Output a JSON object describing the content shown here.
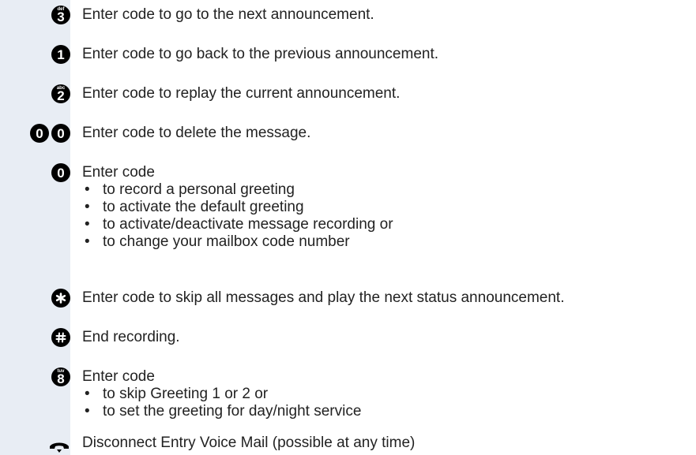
{
  "rows": [
    {
      "key": {
        "digit": "3",
        "letters": "def"
      },
      "text": "Enter code to go to the next announcement."
    },
    {
      "key": {
        "digit": "1",
        "letters": ""
      },
      "text": "Enter code to go back to the previous announcement."
    },
    {
      "key": {
        "digit": "2",
        "letters": "abc"
      },
      "text": "Enter code to replay the current announcement."
    },
    {
      "keys": [
        "0",
        "0"
      ],
      "text": "Enter code to delete the message."
    },
    {
      "key": {
        "digit": "0"
      },
      "text": "Enter code",
      "bullets": [
        "to record a personal greeting",
        "to activate the default greeting",
        "to activate/deactivate message recording or",
        "to change your mailbox code number"
      ]
    },
    {
      "key": {
        "symbol": "*"
      },
      "text": "Enter code to skip all messages and play the next status announcement."
    },
    {
      "key": {
        "symbol": "#"
      },
      "text": "End recording."
    },
    {
      "key": {
        "digit": "8",
        "letters": "tuv"
      },
      "text": "Enter code",
      "bullets": [
        "to skip Greeting 1 or 2 or",
        "to set the greeting for day/night service"
      ]
    },
    {
      "text": "Disconnect Entry Voice Mail (possible at any time)"
    }
  ],
  "icons": {
    "asterisk": "asterisk-key-icon",
    "hash": "hash-key-icon",
    "handset": "handset-hang-up-icon"
  }
}
